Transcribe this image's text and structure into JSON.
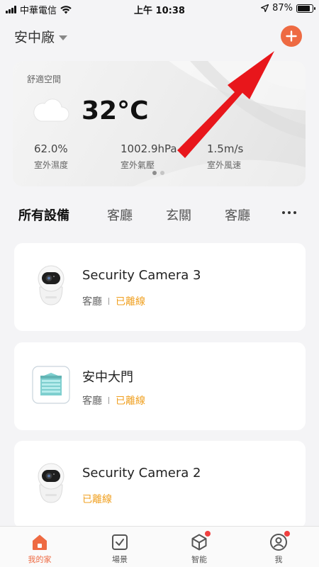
{
  "status_bar": {
    "carrier": "中華電信",
    "time": "上午 10:38",
    "battery": "87%",
    "battery_level": 0.87
  },
  "header": {
    "home_name": "安中廠"
  },
  "weather": {
    "label": "舒適空間",
    "temperature": "32°C",
    "stats": [
      {
        "value": "62.0%",
        "label": "室外濕度"
      },
      {
        "value": "1002.9hPa",
        "label": "室外氣壓"
      },
      {
        "value": "1.5m/s",
        "label": "室外風速"
      }
    ]
  },
  "tabs": [
    "所有設備",
    "客廳",
    "玄關",
    "客廳"
  ],
  "devices": [
    {
      "name": "Security Camera 3",
      "room": "客廳",
      "status": "已離線",
      "icon": "camera-icon"
    },
    {
      "name": "安中大門",
      "room": "客廳",
      "status": "已離線",
      "icon": "garage-door-icon"
    },
    {
      "name": "Security Camera 2",
      "room": "",
      "status": "已離線",
      "icon": "camera-icon"
    }
  ],
  "tabbar": {
    "items": [
      {
        "label": "我的家",
        "icon": "home-icon",
        "active": true
      },
      {
        "label": "場景",
        "icon": "scene-check-icon",
        "active": false
      },
      {
        "label": "智能",
        "icon": "smart-cube-icon",
        "active": false
      },
      {
        "label": "我",
        "icon": "profile-icon",
        "active": false
      }
    ]
  },
  "colors": {
    "accent": "#ee6a42",
    "offline": "#f0a020",
    "annotation": "#e8161b"
  }
}
